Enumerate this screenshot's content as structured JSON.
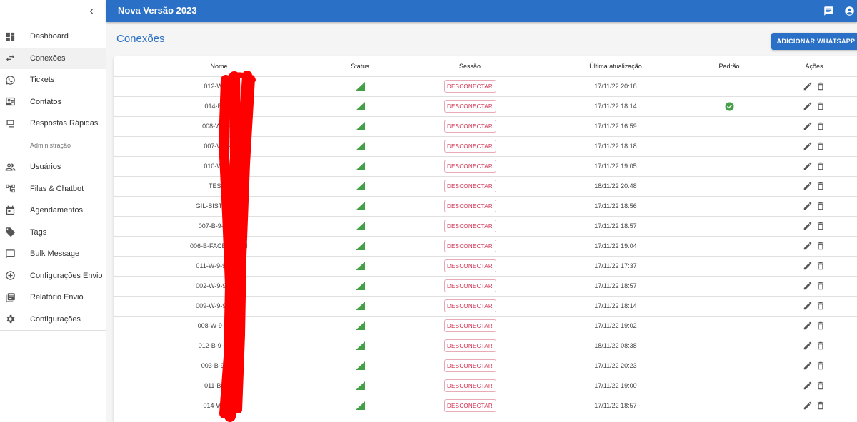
{
  "sidebar": {
    "items": [
      {
        "label": "Dashboard",
        "icon": "dashboard-icon"
      },
      {
        "label": "Conexões",
        "icon": "sync-arrows-icon"
      },
      {
        "label": "Tickets",
        "icon": "whatsapp-icon"
      },
      {
        "label": "Contatos",
        "icon": "contact-card-icon"
      },
      {
        "label": "Respostas Rápidas",
        "icon": "quick-reply-icon"
      }
    ],
    "admin_header": "Administração",
    "admin_items": [
      {
        "label": "Usuários",
        "icon": "users-icon"
      },
      {
        "label": "Filas & Chatbot",
        "icon": "queue-tree-icon"
      },
      {
        "label": "Agendamentos",
        "icon": "calendar-icon"
      },
      {
        "label": "Tags",
        "icon": "tag-icon"
      },
      {
        "label": "Bulk Message",
        "icon": "message-icon"
      },
      {
        "label": "Configurações Envio",
        "icon": "add-circle-icon"
      },
      {
        "label": "Relatório Envio",
        "icon": "report-icon"
      },
      {
        "label": "Configurações",
        "icon": "gear-icon"
      }
    ]
  },
  "topbar": {
    "title": "Nova Versão 2023"
  },
  "main": {
    "title": "Conexões",
    "add_button": "ADICIONAR WHATSAPP"
  },
  "table": {
    "headers": {
      "name": "Nome",
      "status": "Status",
      "session": "Sessão",
      "updated": "Última atualização",
      "default": "Padrão",
      "actions": "Ações"
    },
    "session_label": "DESCONECTAR",
    "rows": [
      {
        "name": "012-W-9-9",
        "updated": "17/11/22 20:18",
        "default": false
      },
      {
        "name": "014-B-9-9",
        "updated": "17/11/22 18:14",
        "default": true
      },
      {
        "name": "008-W-C-9-",
        "updated": "17/11/22 16:59",
        "default": false
      },
      {
        "name": "007-W-9-9",
        "updated": "17/11/22 18:18",
        "default": false
      },
      {
        "name": "010-W-9-9",
        "updated": "17/11/22 19:05",
        "default": false
      },
      {
        "name": "TESTE",
        "updated": "18/11/22 20:48",
        "default": false
      },
      {
        "name": "GIL-SIST-9-9     57",
        "updated": "17/11/22 18:56",
        "default": false
      },
      {
        "name": "007-B-9-91     75",
        "updated": "17/11/22 18:57",
        "default": false
      },
      {
        "name": "006-B-FACE-9     7684",
        "updated": "17/11/22 19:04",
        "default": false
      },
      {
        "name": "011-W-9-91     945",
        "updated": "17/11/22 17:37",
        "default": false
      },
      {
        "name": "002-W-9-91     280",
        "updated": "17/11/22 18:57",
        "default": false
      },
      {
        "name": "009-W-9-91     342",
        "updated": "17/11/22 18:14",
        "default": false
      },
      {
        "name": "008-W-9-9     901",
        "updated": "17/11/22 19:02",
        "default": false
      },
      {
        "name": "012-B-9-9     023",
        "updated": "18/11/22 08:38",
        "default": false
      },
      {
        "name": "003-B-9     327",
        "updated": "17/11/22 20:23",
        "default": false
      },
      {
        "name": "011-B     318",
        "updated": "17/11/22 19:00",
        "default": false
      },
      {
        "name": "014-W     020",
        "updated": "17/11/22 18:57",
        "default": false
      }
    ]
  },
  "colors": {
    "primary": "#2a70c6",
    "status_green": "#43a047",
    "danger": "#d32f4f",
    "redaction": "#ff0000"
  }
}
